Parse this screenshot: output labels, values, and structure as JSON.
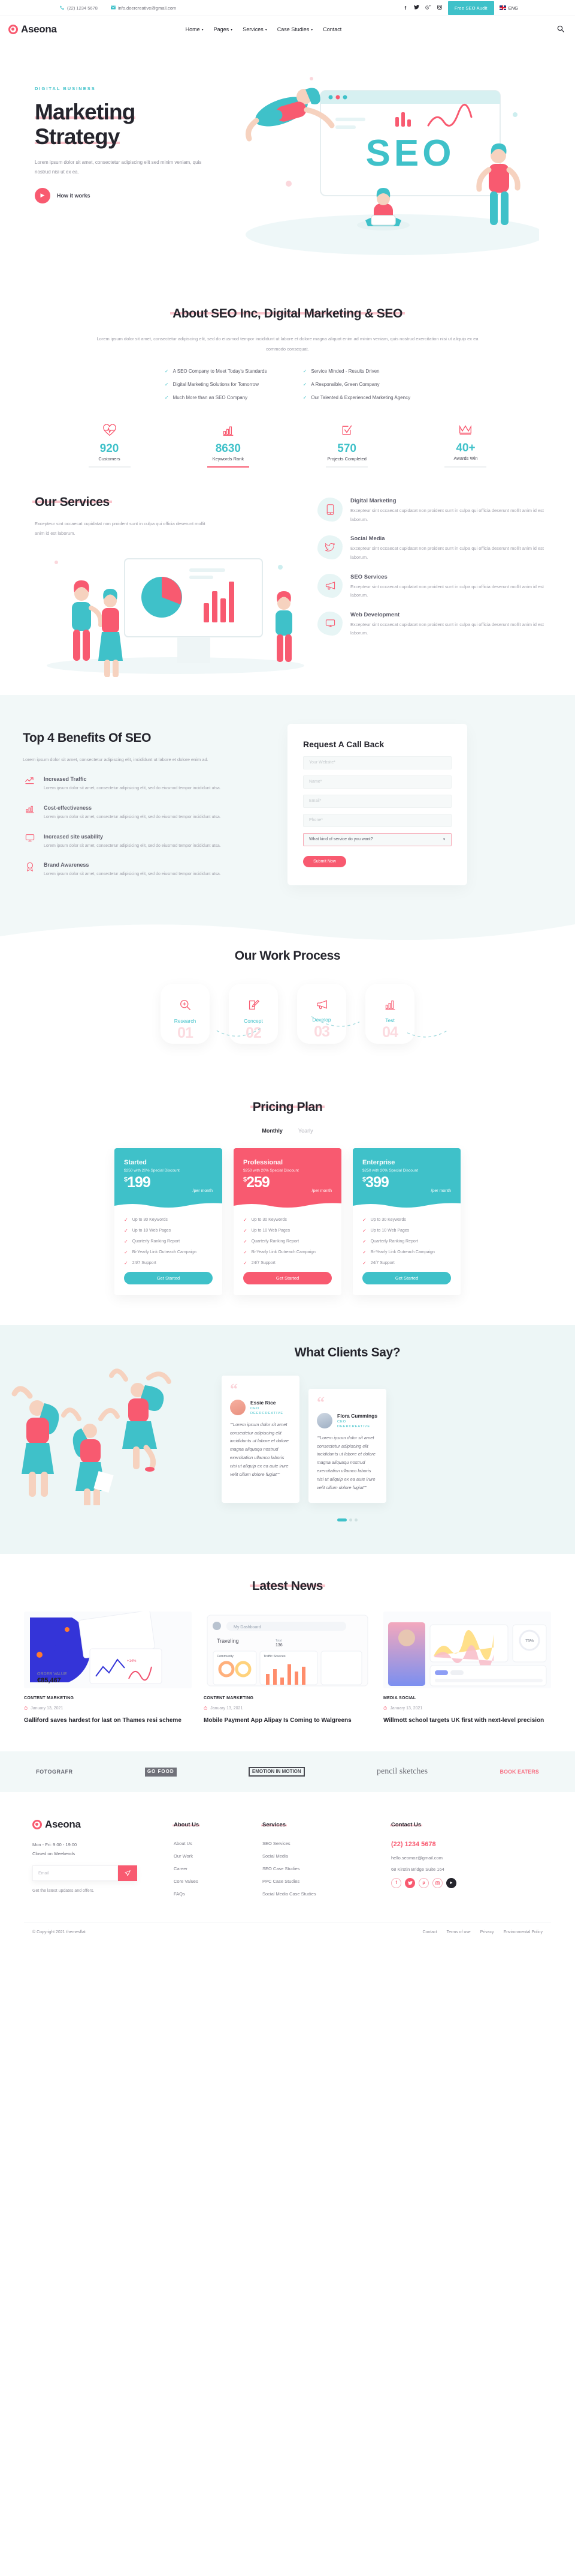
{
  "topbar": {
    "phone": "(22) 1234 5678",
    "email": "info.deercreative@gmail.com",
    "socials": [
      "f",
      "t",
      "g",
      "i"
    ],
    "audit_button": "Free SEO Audit",
    "language": "ENG"
  },
  "nav": {
    "brand": "Aseona",
    "items": [
      {
        "label": "Home",
        "caret": "▾"
      },
      {
        "label": "Pages",
        "caret": "▾"
      },
      {
        "label": "Services",
        "caret": "▾"
      },
      {
        "label": "Case Studies",
        "caret": "▾"
      },
      {
        "label": "Contact",
        "caret": ""
      }
    ],
    "search_icon": "⌕"
  },
  "hero": {
    "eyebrow": "DIGITAL BUSINESS",
    "title_line1": "Marketing",
    "title_line2": "Strategy",
    "paragraph": "Lorem ipsum dolor sit amet, consectetur adipiscing elit sed minim veniam, quis nostrud nisi ut ex ea.",
    "cta": "How it works",
    "art_text": "SEO"
  },
  "about": {
    "title": "About SEO Inc, Digital Marketing & SEO",
    "paragraph": "Lorem ipsum dolor sit amet, consectetur adipiscing elit, sed do eiusmod tempor incididunt ut labore et dolore magna aliquat enim ad minim veniam, quis nostrud exercitation nisi ut aliquip ex ea commodo consequat.",
    "checks_left": [
      "A SEO Company to Meet Today's Standards",
      "Digital Marketing Solutions for Tomorrow",
      "Much More than an SEO Company"
    ],
    "checks_right": [
      "Service Minded - Results Driven",
      "A Responsible, Green Company",
      "Our Talented & Experienced Marketing Agency"
    ]
  },
  "stats": [
    {
      "icon": "heart-pulse-icon",
      "glyph": "♥",
      "value": "920",
      "label": "Customers"
    },
    {
      "icon": "bar-chart-icon",
      "glyph": "▥",
      "value": "8630",
      "label": "Keywords Rank",
      "active": true
    },
    {
      "icon": "checklist-icon",
      "glyph": "✓",
      "value": "570",
      "label": "Projects Completed"
    },
    {
      "icon": "crown-icon",
      "glyph": "♛",
      "value": "40+",
      "label": "Awards Win"
    }
  ],
  "services": {
    "title": "Our Services",
    "paragraph": "Excepteur sint occaecat cupidatat non proident sunt in culpa qui officia deserunt mollit anim id est laborum.",
    "items": [
      {
        "icon": "mobile-icon",
        "glyph": "▯",
        "title": "Digital Marketing",
        "text": "Excepteur sint occaecat cupidatat non proident sunt in culpa qui officia deserunt mollit anim id est laborum."
      },
      {
        "icon": "twitter-bird-icon",
        "glyph": "❧",
        "title": "Social Media",
        "text": "Excepteur sint occaecat cupidatat non proident sunt in culpa qui officia deserunt mollit anim id est laborum."
      },
      {
        "icon": "megaphone-icon",
        "glyph": "◁",
        "title": "SEO Services",
        "text": "Excepteur sint occaecat cupidatat non proident sunt in culpa qui officia deserunt mollit anim id est laborum."
      },
      {
        "icon": "monitor-icon",
        "glyph": "▭",
        "title": "Web Development",
        "text": "Excepteur sint occaecat cupidatat non proident sunt in culpa qui officia deserunt mollit anim id est laborum."
      }
    ]
  },
  "benefits": {
    "title": "Top 4 Benefits Of SEO",
    "paragraph": "Lorem ipsum dolor sit amet, consectetur adipiscing elit, incididunt ut labore et dolore enim ad.",
    "items": [
      {
        "icon": "trend-up-icon",
        "glyph": "↗",
        "title": "Increased Traffic",
        "text": "Lorem ipsum dolor sit amet, consectetur adipisicing elit, sed do eiusmod tempor incididunt utsa."
      },
      {
        "icon": "bar-chart-icon",
        "glyph": "▥",
        "title": "Cost-effectiveness",
        "text": "Lorem ipsum dolor sit amet, consectetur adipisicing elit, sed do eiusmod tempor incididunt utsa."
      },
      {
        "icon": "monitor-icon",
        "glyph": "▭",
        "title": "Increased site usability",
        "text": "Lorem ipsum dolor sit amet, consectetur adipisicing elit, sed do eiusmod tempor incididunt utsa."
      },
      {
        "icon": "award-icon",
        "glyph": "✦",
        "title": "Brand Awareness",
        "text": "Lorem ipsum dolor sit amet, consectetur adipisicing elit, sed do eiusmod tempor incididunt utsa."
      }
    ],
    "form": {
      "title": "Request A Call Back",
      "website_placeholder": "Your Website*",
      "name_placeholder": "Name*",
      "email_placeholder": "Email*",
      "phone_placeholder": "Phone*",
      "service_value": "What kind of service do you want?",
      "submit": "Submit Now"
    }
  },
  "process": {
    "title": "Our Work Process",
    "steps": [
      {
        "icon": "search-plus-icon",
        "glyph": "⊕",
        "name": "Research",
        "number": "01"
      },
      {
        "icon": "pencil-edit-icon",
        "glyph": "✎",
        "name": "Concept",
        "number": "02"
      },
      {
        "icon": "megaphone-icon",
        "glyph": "◁",
        "name": "Develop",
        "number": "03"
      },
      {
        "icon": "bar-chart-icon",
        "glyph": "▥",
        "name": "Test",
        "number": "04"
      }
    ]
  },
  "pricing": {
    "title": "Pricing Plan",
    "toggle": {
      "monthly": "Monthly",
      "yearly": "Yearly",
      "active": "Monthly"
    },
    "plans": [
      {
        "name": "Started",
        "discount": "$250 with 20% Special Discount",
        "currency": "$",
        "price": "199",
        "period": "/per month",
        "theme": "teal",
        "features": [
          "Up to 30 Keywords",
          "Up to 10 Web Pages",
          "Quarterly Ranking Report",
          "Bi-Yearly Link Outreach Campaign",
          "24/7 Support"
        ],
        "button": "Get Started"
      },
      {
        "name": "Professional",
        "discount": "$250 with 20% Special Discount",
        "currency": "$",
        "price": "259",
        "period": "/per month",
        "theme": "pink",
        "features": [
          "Up to 30 Keywords",
          "Up to 10 Web Pages",
          "Quarterly Ranking Report",
          "Bi-Yearly Link Outreach Campaign",
          "24/7 Support"
        ],
        "button": "Get Started"
      },
      {
        "name": "Enterprise",
        "discount": "$250 with 20% Special Discount",
        "currency": "$",
        "price": "399",
        "period": "/per month",
        "theme": "teal",
        "features": [
          "Up to 30 Keywords",
          "Up to 10 Web Pages",
          "Quarterly Ranking Report",
          "Bi-Yearly Link Outreach Campaign",
          "24/7 Support"
        ],
        "button": "Get Started"
      }
    ]
  },
  "testimonials": {
    "title": "What Clients Say?",
    "items": [
      {
        "name": "Essie Rice",
        "role": "CEO",
        "company": "DEERCREATIVE",
        "quote": "“Lorem ipsum dolor sit amet consectetur adipiscing elit incididunts ut labore et dolore magna aliquaqu nostrud exercitation ullamco laboris nisi ut aliquip ex ea aute irure velit cillum dolore fugiat”"
      },
      {
        "name": "Flora Cummings",
        "role": "CEO",
        "company": "DEERCREATIVE",
        "quote": "“Lorem ipsum dolor sit amet consectetur adipiscing elit incididunts ut labore et dolore magna aliquaqu nostrud exercitation ullamco laboris nisi ut aliquip ex ea aute irure velit cillum dolore fugiat”"
      }
    ]
  },
  "news": {
    "title": "Latest News",
    "items": [
      {
        "category": "CONTENT MARKETING",
        "date": "January 13, 2021",
        "title": "Galliford saves hardest for last on Thames resi scheme"
      },
      {
        "category": "CONTENT MARKETING",
        "date": "January 13, 2021",
        "title": "Mobile Payment App Alipay Is Coming to Walgreens"
      },
      {
        "category": "MEDIA SOCIAL",
        "date": "January 13, 2021",
        "title": "Willmott school targets UK first with next-level precision"
      }
    ]
  },
  "clients": [
    {
      "name": "FOTOGRAFR",
      "style": "lg1"
    },
    {
      "name": "GO FOOD",
      "style": "lg2"
    },
    {
      "name": "EMOTION IN MOTION",
      "style": "lg3"
    },
    {
      "name": "pencil sketches",
      "style": "lg4"
    },
    {
      "name": "BOOK EATERS",
      "style": "lg5"
    }
  ],
  "footer": {
    "brand": "Aseona",
    "hours_line1": "Mon - Fri: 9:00 - 19:00",
    "hours_line2": "Closed on Weekends",
    "email_placeholder": "Email",
    "send_icon": "➤",
    "note": "Get the latest updates and offers.",
    "about": {
      "heading": "About Us",
      "links": [
        "About Us",
        "Our Work",
        "Career",
        "Core Values",
        "FAQs"
      ]
    },
    "services": {
      "heading": "Services",
      "links": [
        "SEO Services",
        "Social Media",
        "SEO Case Studies",
        "PPC Case Studies",
        "Social Media Case Studies"
      ]
    },
    "contact": {
      "heading": "Contact Us",
      "phone": "(22) 1234 5678",
      "email": "hello.seomoz@gmail.com",
      "address": "68 Kirstin Bridge Suite 164",
      "socials": [
        "f",
        "t",
        "p",
        "i",
        "▸"
      ]
    },
    "copyright": "© Copyright 2021 themesflat",
    "links": [
      "Contact",
      "Terms of use",
      "Privacy",
      "Environmental Policy"
    ]
  },
  "colors": {
    "pink": "#f85a70",
    "teal": "#3fc1c9",
    "dark": "#25252d",
    "light_bg": "#f2f8f8"
  }
}
